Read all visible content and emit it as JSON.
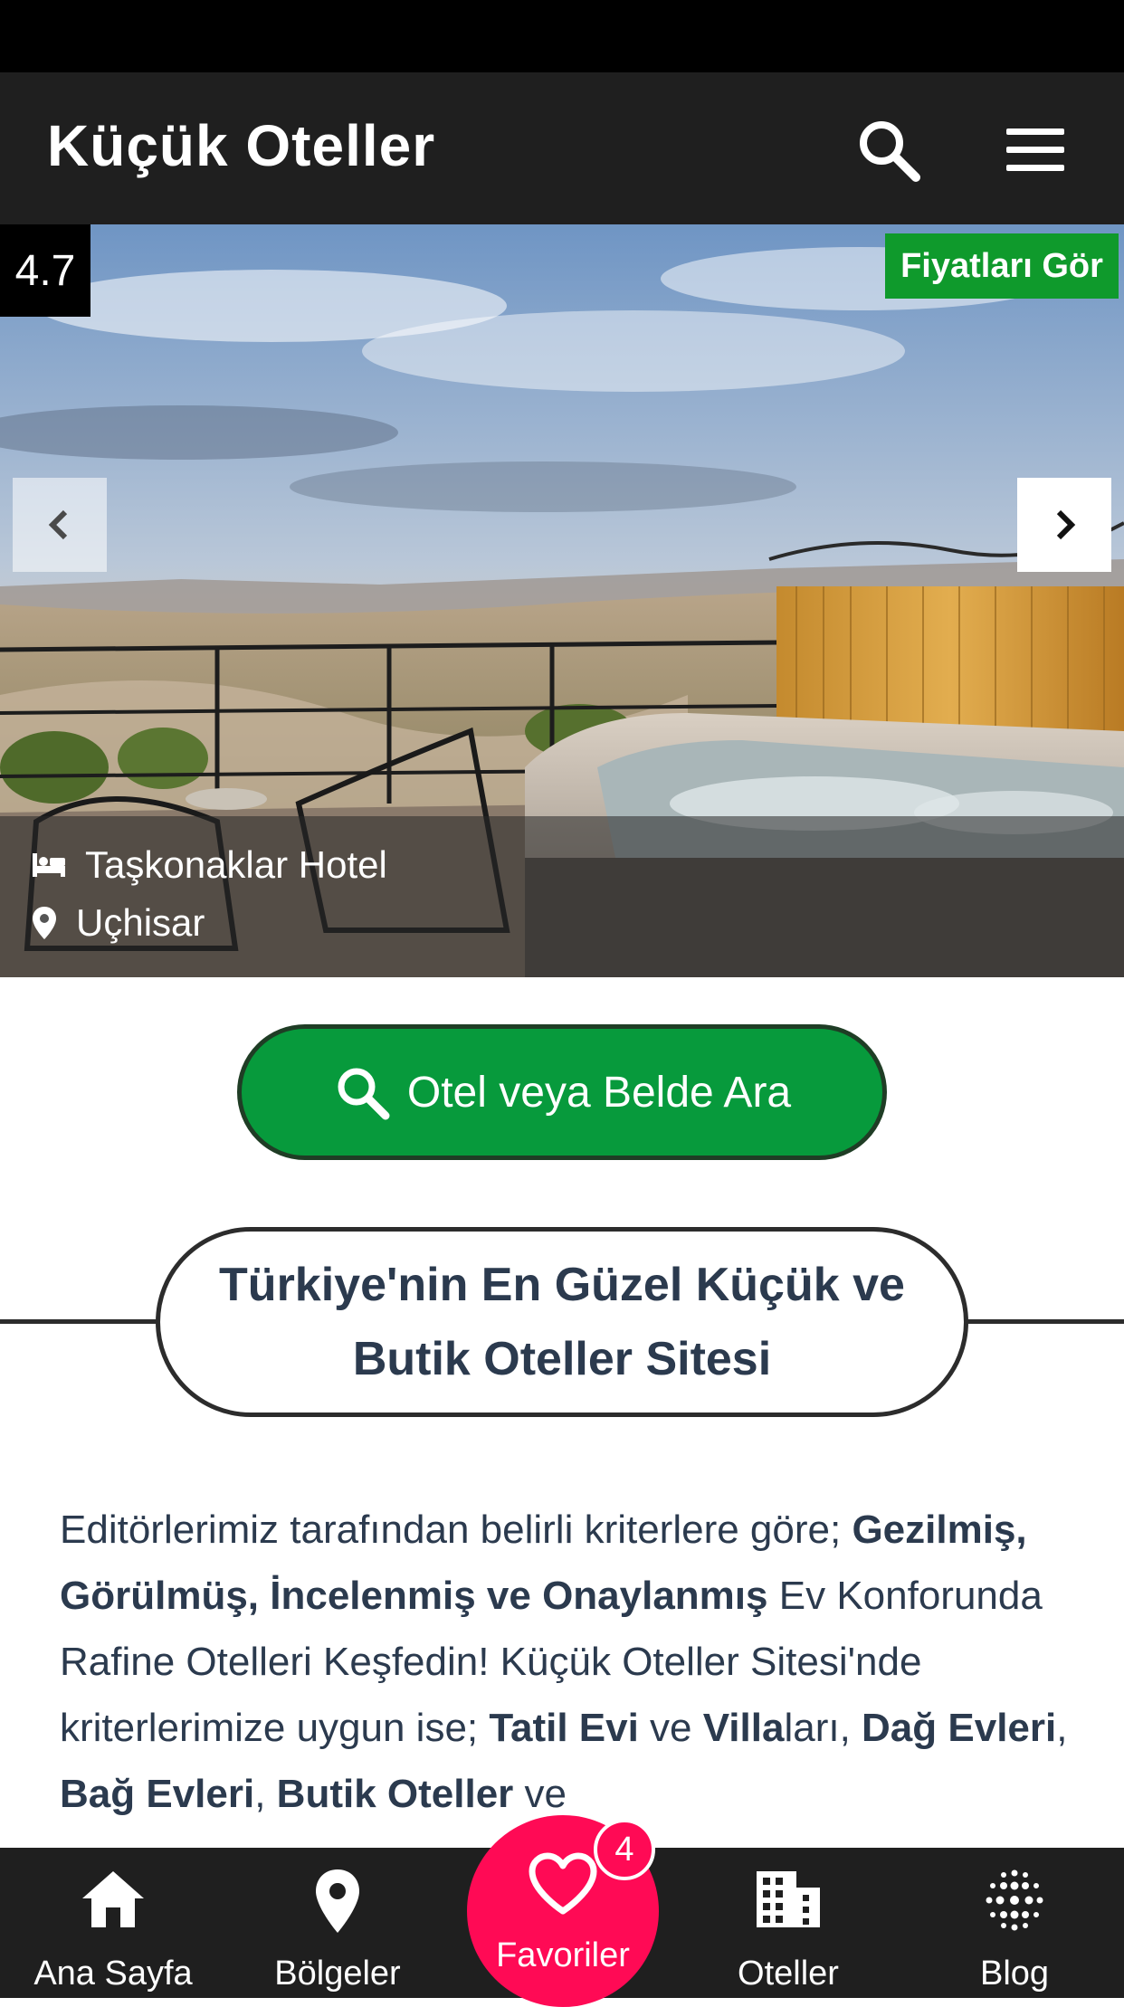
{
  "header": {
    "title": "Küçük Oteller"
  },
  "hero": {
    "rating": "4.7",
    "price_button": "Fiyatları Gör",
    "hotel_name": "Taşkonaklar Hotel",
    "location": "Uçhisar"
  },
  "search_cta": {
    "label": "Otel veya Belde Ara"
  },
  "section": {
    "title": "Türkiye'nin En Güzel Küçük ve Butik Oteller Sitesi"
  },
  "intro": {
    "t1": "Editörlerimiz tarafından belirli kriterlere göre; ",
    "b1": "Gezilmiş, Görülmüş, İncelenmiş ve Onaylanmış",
    "t2": " Ev Konforunda Rafine Otelleri Keşfedin! Küçük Oteller Sitesi'nde kriterlerimize uygun ise; ",
    "b2": "Tatil Evi",
    "t3": " ve ",
    "b3": "Villa",
    "t4": "ları, ",
    "b4": "Dağ Evleri",
    "t5": ", ",
    "b5": "Bağ Evleri",
    "t6": ", ",
    "b6": "Butik Oteller",
    "t7": " ve"
  },
  "bottom_nav": {
    "home": "Ana Sayfa",
    "regions": "Bölgeler",
    "favorites": "Favoriler",
    "favorites_count": "4",
    "hotels": "Oteller",
    "blog": "Blog"
  },
  "colors": {
    "header_bg": "#1f1f1f",
    "cta_green": "#079a3c",
    "price_green": "#0f9a2c",
    "favorite_pink": "#ff0a55",
    "heading_text": "#2b3a4e"
  }
}
